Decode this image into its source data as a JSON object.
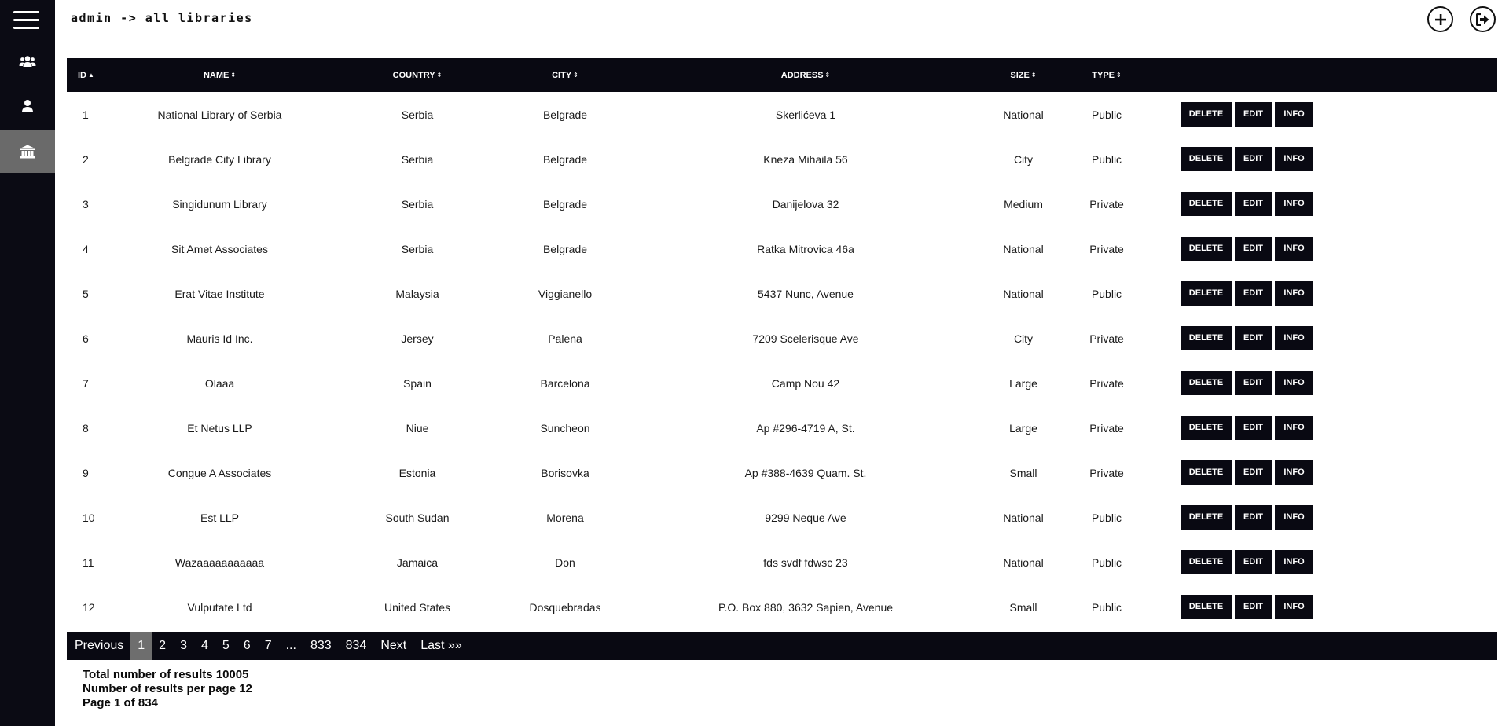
{
  "header": {
    "title": "admin -> all libraries"
  },
  "sidebar": {
    "menu_icon": "hamburger-menu-icon",
    "items": [
      {
        "icon": "users-group-icon",
        "active": false
      },
      {
        "icon": "user-icon",
        "active": false
      },
      {
        "icon": "library-building-icon",
        "active": true
      }
    ]
  },
  "actions": {
    "add_icon": "plus-circle-icon",
    "logout_icon": "logout-icon"
  },
  "table": {
    "columns": [
      {
        "label": "ID",
        "sort": "▲"
      },
      {
        "label": "NAME",
        "sort": "⇕"
      },
      {
        "label": "COUNTRY",
        "sort": "⇕"
      },
      {
        "label": "CITY",
        "sort": "⇕"
      },
      {
        "label": "ADDRESS",
        "sort": "⇕"
      },
      {
        "label": "SIZE",
        "sort": "⇕"
      },
      {
        "label": "TYPE",
        "sort": "⇕"
      }
    ],
    "row_buttons": {
      "delete": "DELETE",
      "edit": "EDIT",
      "info": "INFO"
    },
    "rows": [
      {
        "id": "1",
        "name": "National Library of Serbia",
        "country": "Serbia",
        "city": "Belgrade",
        "address": "Skerlićeva 1",
        "size": "National",
        "type": "Public"
      },
      {
        "id": "2",
        "name": "Belgrade City Library",
        "country": "Serbia",
        "city": "Belgrade",
        "address": "Kneza Mihaila 56",
        "size": "City",
        "type": "Public"
      },
      {
        "id": "3",
        "name": "Singidunum Library",
        "country": "Serbia",
        "city": "Belgrade",
        "address": "Danijelova 32",
        "size": "Medium",
        "type": "Private"
      },
      {
        "id": "4",
        "name": "Sit Amet Associates",
        "country": "Serbia",
        "city": "Belgrade",
        "address": "Ratka Mitrovica 46a",
        "size": "National",
        "type": "Private"
      },
      {
        "id": "5",
        "name": "Erat Vitae Institute",
        "country": "Malaysia",
        "city": "Viggianello",
        "address": "5437 Nunc, Avenue",
        "size": "National",
        "type": "Public"
      },
      {
        "id": "6",
        "name": "Mauris Id Inc.",
        "country": "Jersey",
        "city": "Palena",
        "address": "7209 Scelerisque Ave",
        "size": "City",
        "type": "Private"
      },
      {
        "id": "7",
        "name": "Olaaa",
        "country": "Spain",
        "city": "Barcelona",
        "address": "Camp Nou 42",
        "size": "Large",
        "type": "Private"
      },
      {
        "id": "8",
        "name": "Et Netus LLP",
        "country": "Niue",
        "city": "Suncheon",
        "address": "Ap #296-4719 A, St.",
        "size": "Large",
        "type": "Private"
      },
      {
        "id": "9",
        "name": "Congue A Associates",
        "country": "Estonia",
        "city": "Borisovka",
        "address": "Ap #388-4639 Quam. St.",
        "size": "Small",
        "type": "Private"
      },
      {
        "id": "10",
        "name": "Est LLP",
        "country": "South Sudan",
        "city": "Morena",
        "address": "9299 Neque Ave",
        "size": "National",
        "type": "Public"
      },
      {
        "id": "11",
        "name": "Wazaaaaaaaaaaa",
        "country": "Jamaica",
        "city": "Don",
        "address": "fds svdf fdwsc 23",
        "size": "National",
        "type": "Public"
      },
      {
        "id": "12",
        "name": "Vulputate Ltd",
        "country": "United States",
        "city": "Dosquebradas",
        "address": "P.O. Box 880, 3632 Sapien, Avenue",
        "size": "Small",
        "type": "Public"
      }
    ]
  },
  "pagination": {
    "previous": "Previous",
    "pages": [
      "1",
      "2",
      "3",
      "4",
      "5",
      "6",
      "7",
      "...",
      "833",
      "834"
    ],
    "active_page": "1",
    "next": "Next",
    "last": "Last »»"
  },
  "summary": {
    "total": "Total number of results 10005",
    "per_page": "Number of results per page 12",
    "page": "Page 1 of 834"
  }
}
